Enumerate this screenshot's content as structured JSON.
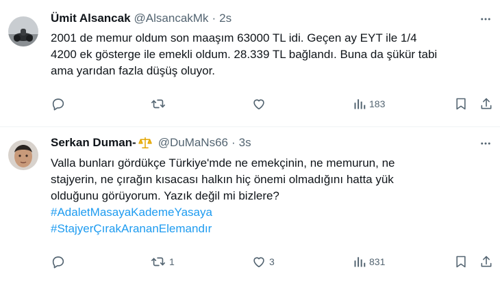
{
  "tweets": [
    {
      "author_name": "Ümit Alsancak",
      "handle": "@AlsancakMk",
      "separator": "·",
      "time": "2s",
      "lines": [
        "2001 de memur oldum son maaşım 63000 TL idi. Geçen ay EYT ile 1/4",
        "4200 ek gösterge ile emekli oldum. 28.339 TL bağlandı. Buna da şükür tabi",
        "ama yarıdan fazla düşüş oluyor."
      ],
      "hashtags": [],
      "reply_count": "",
      "retweet_count": "",
      "like_count": "",
      "views": "183"
    },
    {
      "author_name": "Serkan Duman-",
      "name_emoji": "scales-icon",
      "handle": "@DuMaNs66",
      "separator": "·",
      "time": "3s",
      "lines": [
        "Valla bunları gördükçe Türkiye'mde ne emekçinin, ne memurun, ne",
        "stajyerin, ne çırağın kısacası halkın hiç önemi olmadığını hatta yük",
        "olduğunu görüyorum. Yazık değil mi bizlere?"
      ],
      "hashtags": [
        "#AdaletMasayaKademeYasaya",
        "#StajyerÇırakArananElemandır"
      ],
      "reply_count": "",
      "retweet_count": "1",
      "like_count": "3",
      "views": "831"
    }
  ],
  "colors": {
    "text": "#0f1419",
    "secondary": "#536471",
    "link": "#1d9bf0",
    "divider": "#eff3f4"
  }
}
